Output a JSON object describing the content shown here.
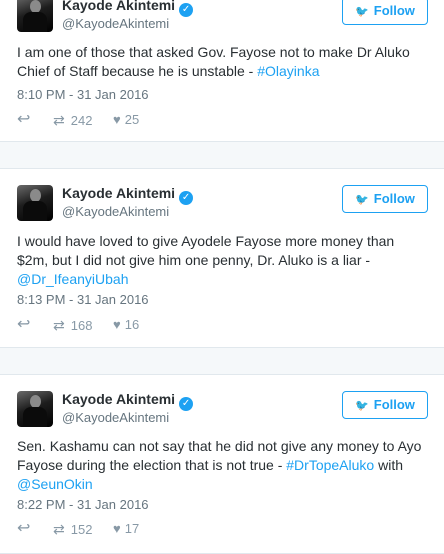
{
  "tweets": [
    {
      "name": "Kayode Akintemi",
      "handle": "@KayodeAkintemi",
      "follow_label": "Follow",
      "text_parts": [
        "I am one of those that asked Gov. Fayose not to make Dr Aluko Chief of Staff because he is unstable - "
      ],
      "links": [
        "#Olayinka"
      ],
      "time": "8:10 PM - 31 Jan 2016",
      "retweets": "242",
      "likes": "25"
    },
    {
      "name": "Kayode Akintemi",
      "handle": "@KayodeAkintemi",
      "follow_label": "Follow",
      "text_parts": [
        "I would have loved to give Ayodele Fayose more money than $2m, but I did not give him one penny, Dr. Aluko is a liar - "
      ],
      "links": [
        "@Dr_IfeanyiUbah"
      ],
      "time": "8:13 PM - 31 Jan 2016",
      "retweets": "168",
      "likes": "16"
    },
    {
      "name": "Kayode Akintemi",
      "handle": "@KayodeAkintemi",
      "follow_label": "Follow",
      "text_parts": [
        "Sen. Kashamu can not say that he did not give any money to Ayo Fayose during the election that is not true - ",
        " with "
      ],
      "links": [
        "#DrTopeAluko",
        "@SeunOkin"
      ],
      "time": "8:22 PM - 31 Jan 2016",
      "retweets": "152",
      "likes": "17"
    }
  ],
  "icons": {
    "verified": "verified-check-icon",
    "follow": "twitter-bird-icon",
    "reply": "reply-arrow-icon",
    "retweet": "retweet-icon",
    "like": "heart-icon"
  },
  "colors": {
    "accent": "#1da1f2",
    "text": "#292f33",
    "muted": "#66757f",
    "icon": "#8899a6",
    "border": "#e1e8ed",
    "gap": "#f5f8fa"
  }
}
